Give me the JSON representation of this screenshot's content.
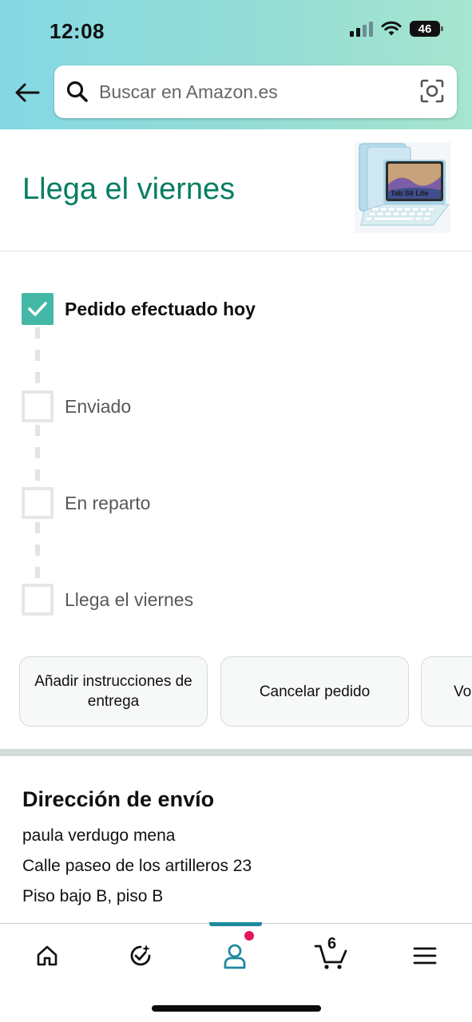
{
  "status_bar": {
    "time": "12:08",
    "battery": "46"
  },
  "search": {
    "placeholder": "Buscar en Amazon.es"
  },
  "arrival": {
    "title": "Llega el viernes",
    "product_image_text": "Tab S6 Lite"
  },
  "tracker": {
    "steps": [
      {
        "label": "Pedido efectuado hoy",
        "done": true
      },
      {
        "label": "Enviado",
        "done": false
      },
      {
        "label": "En reparto",
        "done": false
      },
      {
        "label": "Llega el viernes",
        "done": false
      }
    ]
  },
  "actions": {
    "delivery_instructions": "Añadir instrucciones de entrega",
    "cancel_order": "Cancelar pedido",
    "third_partial": "Vo"
  },
  "address": {
    "heading": "Dirección de envío",
    "lines": [
      "paula verdugo mena",
      "Calle paseo de los artilleros 23",
      "Piso bajo B, piso B"
    ]
  },
  "bottom_nav": {
    "items": [
      "home-icon",
      "rufus-icon",
      "account-icon",
      "cart-icon",
      "menu-icon"
    ],
    "active": "account-icon",
    "cart_count": "6"
  },
  "colors": {
    "accent_green": "#067d62",
    "check_teal": "#43b8a6",
    "header_gradient_start": "#84d8e4",
    "header_gradient_end": "#a6e5cf",
    "notification": "#e3165b"
  }
}
